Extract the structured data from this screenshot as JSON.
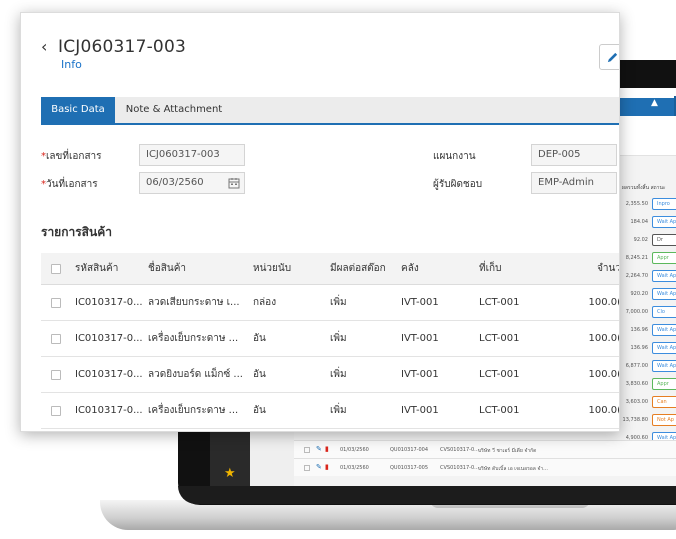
{
  "document": {
    "title": "ICJ060317-003",
    "subtitle": "Info"
  },
  "tabs": [
    "Basic Data",
    "Note & Attachment"
  ],
  "fields": {
    "doc_no_label": "เลขที่เอกสาร",
    "doc_no_value": "ICJ060317-003",
    "doc_date_label": "วันที่เอกสาร",
    "doc_date_value": "06/03/2560",
    "department_label": "แผนกงาน",
    "department_value": "DEP-005",
    "responsible_label": "ผู้รับผิดชอบ",
    "responsible_value": "EMP-Admin"
  },
  "items_section": {
    "title": "รายการสินค้า",
    "columns": [
      "รหัสสินค้า",
      "ชื่อสินค้า",
      "หน่วยนับ",
      "มีผลต่อสต๊อก",
      "คลัง",
      "ที่เก็บ",
      "จำนว"
    ],
    "rows": [
      {
        "code": "IC010317-0...",
        "name": "ลวดเสียบกระดาษ เ...",
        "unit": "กล่อง",
        "effect": "เพิ่ม",
        "warehouse": "IVT-001",
        "location": "LCT-001",
        "qty": "100.0("
      },
      {
        "code": "IC010317-0...",
        "name": "เครื่องเย็บกระดาษ ...",
        "unit": "อัน",
        "effect": "เพิ่ม",
        "warehouse": "IVT-001",
        "location": "LCT-001",
        "qty": "100.0("
      },
      {
        "code": "IC010317-0...",
        "name": "ลวดยิงบอร์ด แม็กซ์ ...",
        "unit": "อัน",
        "effect": "เพิ่ม",
        "warehouse": "IVT-001",
        "location": "LCT-001",
        "qty": "100.0("
      },
      {
        "code": "IC010317-0...",
        "name": "เครื่องเย็บกระดาษ ...",
        "unit": "อัน",
        "effect": "เพิ่ม",
        "warehouse": "IVT-001",
        "location": "LCT-001",
        "qty": "100.0("
      }
    ]
  },
  "background": {
    "header": "ผลรวมทั้งสิ้น  สถานะ",
    "rows": [
      {
        "amount": "2,355.50",
        "status": "Inpro",
        "color": "#3c8dde"
      },
      {
        "amount": "184.04",
        "status": "Wait Ap",
        "color": "#3c8dde"
      },
      {
        "amount": "92.02",
        "status": "Dr",
        "color": "#555555"
      },
      {
        "amount": "8,245.21",
        "status": "Appr",
        "color": "#5cb85c"
      },
      {
        "amount": "2,264.70",
        "status": "Wait Ap",
        "color": "#3c8dde"
      },
      {
        "amount": "920.20",
        "status": "Wait Ap",
        "color": "#3c8dde"
      },
      {
        "amount": "7,000.00",
        "status": "Clo",
        "color": "#3c8dde"
      },
      {
        "amount": "136.96",
        "status": "Wait Ap",
        "color": "#3c8dde"
      },
      {
        "amount": "136.96",
        "status": "Wait Ap",
        "color": "#3c8dde"
      },
      {
        "amount": "6,877.00",
        "status": "Wait Ap",
        "color": "#3c8dde"
      },
      {
        "amount": "3,830.60",
        "status": "Appr",
        "color": "#5cb85c"
      },
      {
        "amount": "3,603.00",
        "status": "Can",
        "color": "#e67e22"
      },
      {
        "amount": "13,738.80",
        "status": "Not Ap",
        "color": "#e67e22"
      },
      {
        "amount": "4,900.60",
        "status": "Wait Ap",
        "color": "#3c8dde"
      }
    ],
    "bottom_rows": [
      {
        "date": "01/03/2560",
        "doc": "QU010317-004",
        "ref": "CVS010317-0...",
        "name": "บริษัท วี ชาเอร์ มีเดีย จำกัด"
      },
      {
        "date": "01/03/2560",
        "doc": "QU010317-005",
        "ref": "CVS010317-0...",
        "name": "บริษัท ดับเบิ้ล เอ เจเนอรอล จำ..."
      }
    ]
  }
}
